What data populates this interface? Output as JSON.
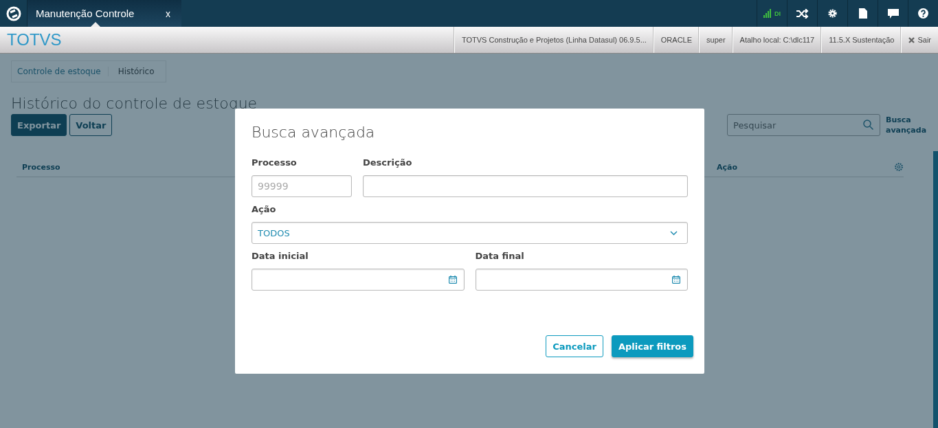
{
  "top_bar": {
    "tab": {
      "title": "Manutenção Controle",
      "close": "x"
    },
    "connection": "DI"
  },
  "header": {
    "logo": "TOTVS",
    "info": [
      "TOTVS Construção e Projetos (Linha Datasul) 06.9.5...",
      "ORACLE",
      "super",
      "Atalho local: C:\\dlc117",
      "11.5.X Sustentação"
    ],
    "logout": "Sair"
  },
  "breadcrumb": [
    "Controle de estoque",
    "Histórico"
  ],
  "page": {
    "title": "Histórico do controle de estoque",
    "buttons": [
      {
        "label": "Exportar",
        "primary": true
      },
      {
        "label": "Voltar",
        "primary": false
      }
    ],
    "search": {
      "placeholder": "Pesquisar"
    },
    "advanced_link": "Busca avançada",
    "table": {
      "columns": [
        "Processo",
        "Ação"
      ]
    }
  },
  "modal": {
    "title": "Busca avançada",
    "rows": [
      [
        {
          "kind": "text",
          "label": "Processo",
          "placeholder": "99999",
          "narrow": true
        },
        {
          "kind": "text",
          "label": "Descrição",
          "narrow": false
        }
      ],
      [
        {
          "kind": "select",
          "label": "Ação",
          "value": "TODOS",
          "narrow": false
        }
      ],
      [
        {
          "kind": "date",
          "label": "Data inicial",
          "narrow": false
        },
        {
          "kind": "date",
          "label": "Data final",
          "narrow": false
        }
      ]
    ],
    "buttons": [
      {
        "label": "Cancelar",
        "primary": false
      },
      {
        "label": "Aplicar filtros",
        "primary": true
      }
    ]
  }
}
